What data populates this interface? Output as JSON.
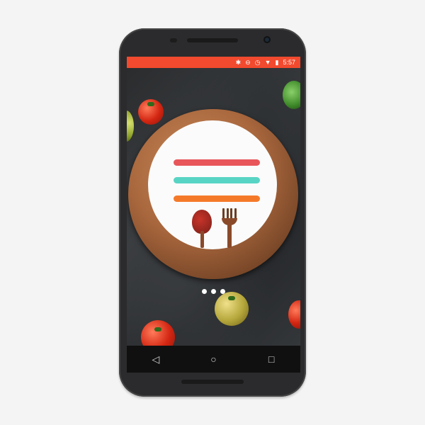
{
  "status_bar": {
    "time": "5:57",
    "icons": [
      "bluetooth-icon",
      "do-not-disturb-icon",
      "alarm-icon",
      "wifi-icon",
      "battery-icon"
    ],
    "background_color": "#f24a2e"
  },
  "splash": {
    "logo_bar_colors": [
      "#e8565a",
      "#58d4c4",
      "#f47a2a"
    ],
    "page_indicator_count": 3
  },
  "nav_bar": {
    "back_icon": "◁",
    "home_icon": "○",
    "recents_icon": "□"
  }
}
